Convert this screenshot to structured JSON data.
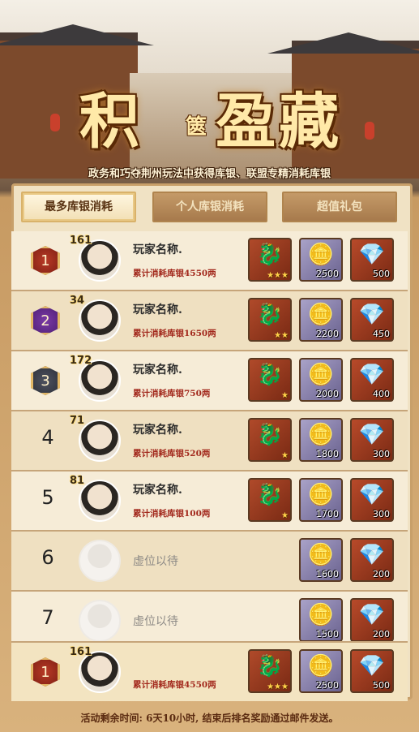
{
  "banner": {
    "title_left": "积",
    "title_mid": "篋",
    "title_right": "盈藏",
    "subtitle": "政务和巧夺荆州玩法中获得库银、联盟专精消耗库银"
  },
  "tabs": [
    {
      "label": "最多库银消耗",
      "active": true
    },
    {
      "label": "个人库银消耗",
      "active": false
    },
    {
      "label": "超值礼包",
      "active": false
    }
  ],
  "rows": [
    {
      "rank": "1",
      "level": "161",
      "name": "玩家名称.",
      "spent": "累计消耗库银4550两",
      "rewards": {
        "gold_stars": "★★★",
        "silver": "2500",
        "gem": "500"
      }
    },
    {
      "rank": "2",
      "level": "34",
      "name": "玩家名称.",
      "spent": "累计消耗库银1650两",
      "rewards": {
        "gold_stars": "★★",
        "silver": "2200",
        "gem": "450"
      }
    },
    {
      "rank": "3",
      "level": "172",
      "name": "玩家名称.",
      "spent": "累计消耗库银750两",
      "rewards": {
        "gold_stars": "★",
        "silver": "2000",
        "gem": "400"
      }
    },
    {
      "rank": "4",
      "level": "71",
      "name": "玩家名称.",
      "spent": "累计消耗库银520两",
      "rewards": {
        "gold_stars": "★",
        "silver": "1800",
        "gem": "300"
      }
    },
    {
      "rank": "5",
      "level": "81",
      "name": "玩家名称.",
      "spent": "累计消耗库银100两",
      "rewards": {
        "gold_stars": "★",
        "silver": "1700",
        "gem": "300"
      }
    },
    {
      "rank": "6",
      "placeholder": "虚位以待",
      "rewards": {
        "silver": "1600",
        "gem": "200"
      }
    },
    {
      "rank": "7",
      "placeholder": "虚位以待",
      "rewards": {
        "silver": "1500",
        "gem": "200"
      }
    }
  ],
  "my_row": {
    "rank": "1",
    "level": "161",
    "spent": "累计消耗库银4550两",
    "rewards": {
      "gold_stars": "★★★",
      "silver": "2500",
      "gem": "500"
    }
  },
  "footer": {
    "countdown": "活动剩余时间: 6天10小时, 结束后排名奖励通过邮件发送。"
  },
  "colors": {
    "accent": "#a2281c",
    "panel": "#f0e2c4",
    "tab": "#a77a4c"
  }
}
